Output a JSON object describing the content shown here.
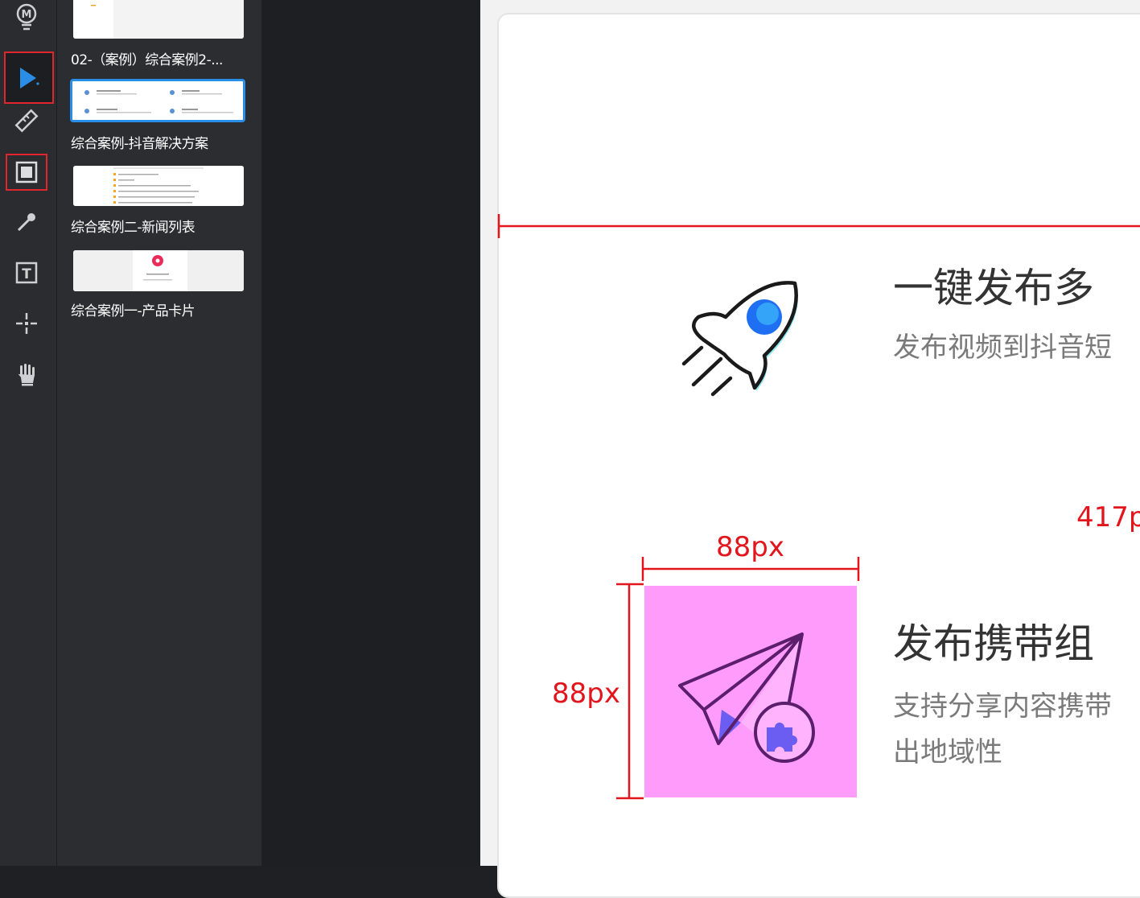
{
  "toolbar": {
    "tools": [
      {
        "name": "logo-icon"
      },
      {
        "name": "select-pointer-icon",
        "selected": true
      },
      {
        "name": "ruler-icon"
      },
      {
        "name": "artboard-icon",
        "highlighted": true
      },
      {
        "name": "eyedropper-icon"
      },
      {
        "name": "text-tool-icon"
      },
      {
        "name": "crosshair-icon"
      },
      {
        "name": "hand-icon"
      }
    ],
    "accent_color": "#2a8de6",
    "highlight_color": "#e0262d"
  },
  "pages": {
    "items": [
      {
        "label": "02-（案例）综合案例2-..."
      },
      {
        "label": "综合案例-抖音解决方案",
        "selected": true
      },
      {
        "label": "综合案例二-新闻列表"
      },
      {
        "label": "综合案例一-产品卡片"
      }
    ]
  },
  "canvas": {
    "feature1": {
      "title": "一键发布多",
      "desc": "发布视频到抖音短",
      "icon": "rocket-icon"
    },
    "feature2": {
      "title": "发布携带组",
      "desc_line1": "支持分享内容携带",
      "desc_line2": "出地域性",
      "icon": "paper-plane-puzzle-icon"
    },
    "measurements": {
      "width_label": "88px",
      "height_label": "88px",
      "distance_label": "417p",
      "color": "#e3151c"
    }
  }
}
